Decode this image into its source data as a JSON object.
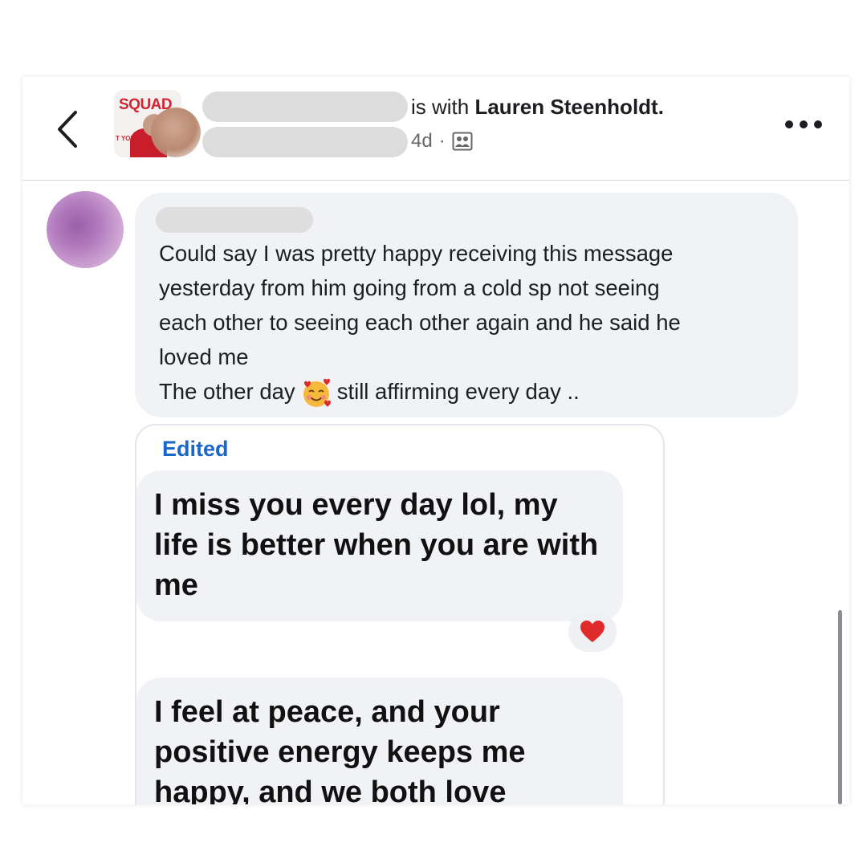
{
  "header": {
    "group_logo_text": "SQUAD",
    "group_logo_subtext": "T YOU",
    "with_prefix": "is with ",
    "tagged_name": "Lauren Steenholdt.",
    "time": "4d",
    "separator": "·",
    "audience_icon": "group-icon",
    "back_icon": "chevron-left-icon",
    "more_icon": "more-horizontal-icon"
  },
  "comment": {
    "lines": [
      "Could say I was pretty happy receiving this message",
      "yesterday from him  going from a cold sp not seeing",
      "each other to seeing each other again and he said he",
      "loved me"
    ],
    "last_line_before": "The other day",
    "last_line_emoji": "smiling-face-with-hearts-emoji",
    "last_line_after": "still affirming every day .."
  },
  "shared_image": {
    "edited_label": "Edited",
    "message_1": "I miss you every day lol, my life is better when you are with me",
    "reaction": "heart",
    "message_2": "I feel at peace, and your positive energy keeps me happy, and we both love"
  },
  "colors": {
    "edited_blue": "#1a66c9",
    "bubble_gray": "#f0f2f5",
    "heart_red": "#e02b2b"
  }
}
